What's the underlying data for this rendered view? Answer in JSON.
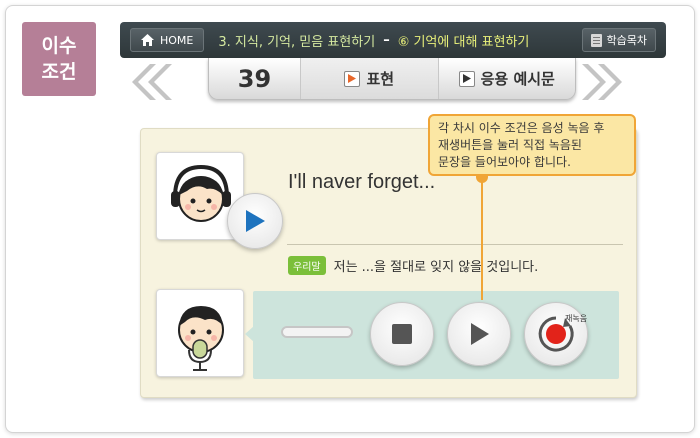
{
  "corner_tag": {
    "line1": "이수",
    "line2": "조건"
  },
  "topbar": {
    "home_label": "HOME",
    "breadcrumb_section": "3. 지식, 기억, 믿음 표현하기",
    "breadcrumb_dash": "–",
    "breadcrumb_sub": "⑥ 기억에 대해 표현하기",
    "toc_label": "학습목차"
  },
  "tabs": {
    "page_number": "39",
    "items": [
      {
        "label": "표현",
        "active": true
      },
      {
        "label": "응용 예시문",
        "active": false
      }
    ]
  },
  "main": {
    "sentence_en": "I'll naver forget...",
    "translation_badge": "우리말",
    "translation_text": "저는 ...을 절대로 잊지 않을 것입니다.",
    "tooltip": [
      "각 차시 이수 조건은 음성 녹음 후",
      "재생버튼을 눌러 직접 녹음된",
      "문장을 들어보아야 합니다."
    ],
    "rerecord_label": "재녹음"
  },
  "colors": {
    "tag_bg": "#b57f97",
    "content_bg": "#f7f3df",
    "panel_bg": "#cde4dc",
    "tooltip_bg": "#fbe7a4",
    "tooltip_border": "#f0a536",
    "play_blue": "#1e73be",
    "record_red": "#e2231a",
    "badge_green": "#7bbf3a"
  }
}
